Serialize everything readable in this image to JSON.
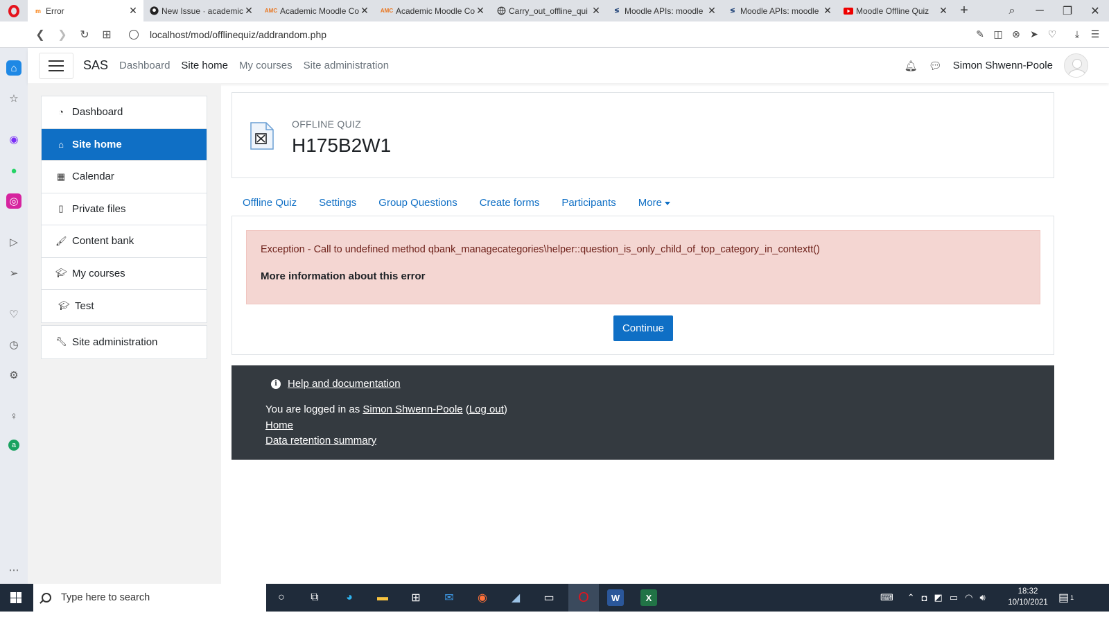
{
  "browser": {
    "tabs": [
      {
        "title": "Error",
        "fav": "moodle-icon",
        "active": true
      },
      {
        "title": "New Issue · academic",
        "fav": "github-icon"
      },
      {
        "title": "Academic Moodle Co",
        "fav": "amc-icon"
      },
      {
        "title": "Academic Moodle Co",
        "fav": "amc-icon"
      },
      {
        "title": "Carry_out_offline_qui",
        "fav": "globe-icon"
      },
      {
        "title": "Moodle APIs: moodle",
        "fav": "moodle-icon"
      },
      {
        "title": "Moodle APIs: moodle",
        "fav": "moodle-icon"
      },
      {
        "title": "Moodle Offline Quiz",
        "fav": "youtube-icon"
      }
    ],
    "amc_label": "AMC",
    "url": "localhost/mod/offlinequiz/addrandom.php"
  },
  "moodle_nav": {
    "brand": "SAS",
    "links": [
      "Dashboard",
      "Site home",
      "My courses",
      "Site administration"
    ],
    "user_name": "Simon Shwenn-Poole"
  },
  "drawer": {
    "items": [
      {
        "label": "Dashboard",
        "icon": "dashboard-icon"
      },
      {
        "label": "Site home",
        "icon": "home-icon"
      },
      {
        "label": "Calendar",
        "icon": "calendar-icon"
      },
      {
        "label": "Private files",
        "icon": "file-icon"
      },
      {
        "label": "Content bank",
        "icon": "brush-icon"
      },
      {
        "label": "My courses",
        "icon": "graduation-cap-icon"
      },
      {
        "label": "Test",
        "icon": "graduation-cap-icon"
      }
    ],
    "admin_label": "Site administration"
  },
  "header": {
    "module_label": "OFFLINE QUIZ",
    "title": "H175B2W1"
  },
  "tabs": [
    "Offline Quiz",
    "Settings",
    "Group Questions",
    "Create forms",
    "Participants",
    "More"
  ],
  "error": {
    "message": "Exception - Call to undefined method qbank_managecategories\\helper::question_is_only_child_of_top_category_in_contextt()",
    "more_info": "More information about this error",
    "continue_label": "Continue"
  },
  "footer": {
    "help": "Help and documentation",
    "logged_prefix": "You are logged in as ",
    "user_name": "Simon Shwenn-Poole",
    "logout": "Log out",
    "home": "Home",
    "retention": "Data retention summary"
  },
  "taskbar": {
    "search_placeholder": "Type here to search",
    "time": "18:32",
    "date": "10/10/2021",
    "notification_count": "1"
  }
}
